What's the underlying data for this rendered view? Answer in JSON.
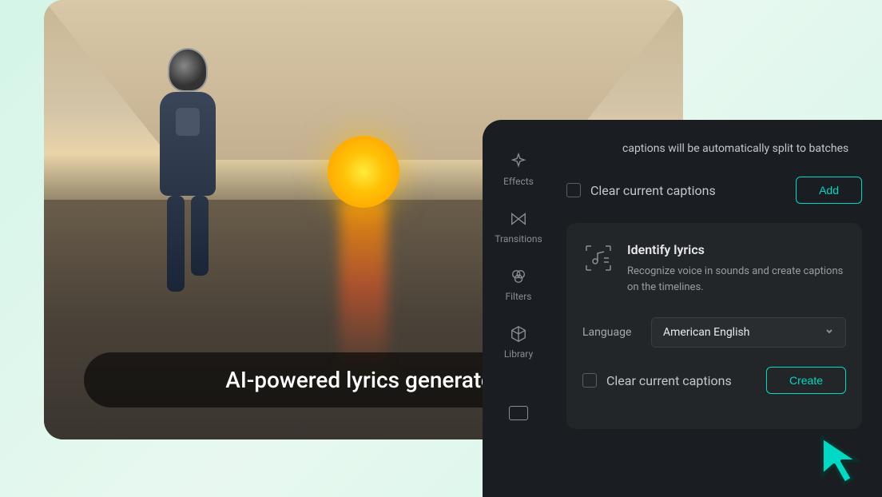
{
  "preview": {
    "caption": "AI-powered lyrics generator"
  },
  "sidebar": {
    "items": [
      {
        "label": "Effects",
        "icon": "sparkle"
      },
      {
        "label": "Transitions",
        "icon": "bowtie"
      },
      {
        "label": "Filters",
        "icon": "filters"
      },
      {
        "label": "Library",
        "icon": "cube"
      }
    ]
  },
  "panel": {
    "info_text": "captions will be automatically split to batches",
    "clear_label": "Clear current captions",
    "add_button": "Add",
    "feature": {
      "title": "Identify lyrics",
      "description": "Recognize voice in sounds and create captions on the timelines."
    },
    "language": {
      "label": "Language",
      "selected": "American English"
    },
    "clear_label_2": "Clear current captions",
    "create_button": "Create"
  }
}
